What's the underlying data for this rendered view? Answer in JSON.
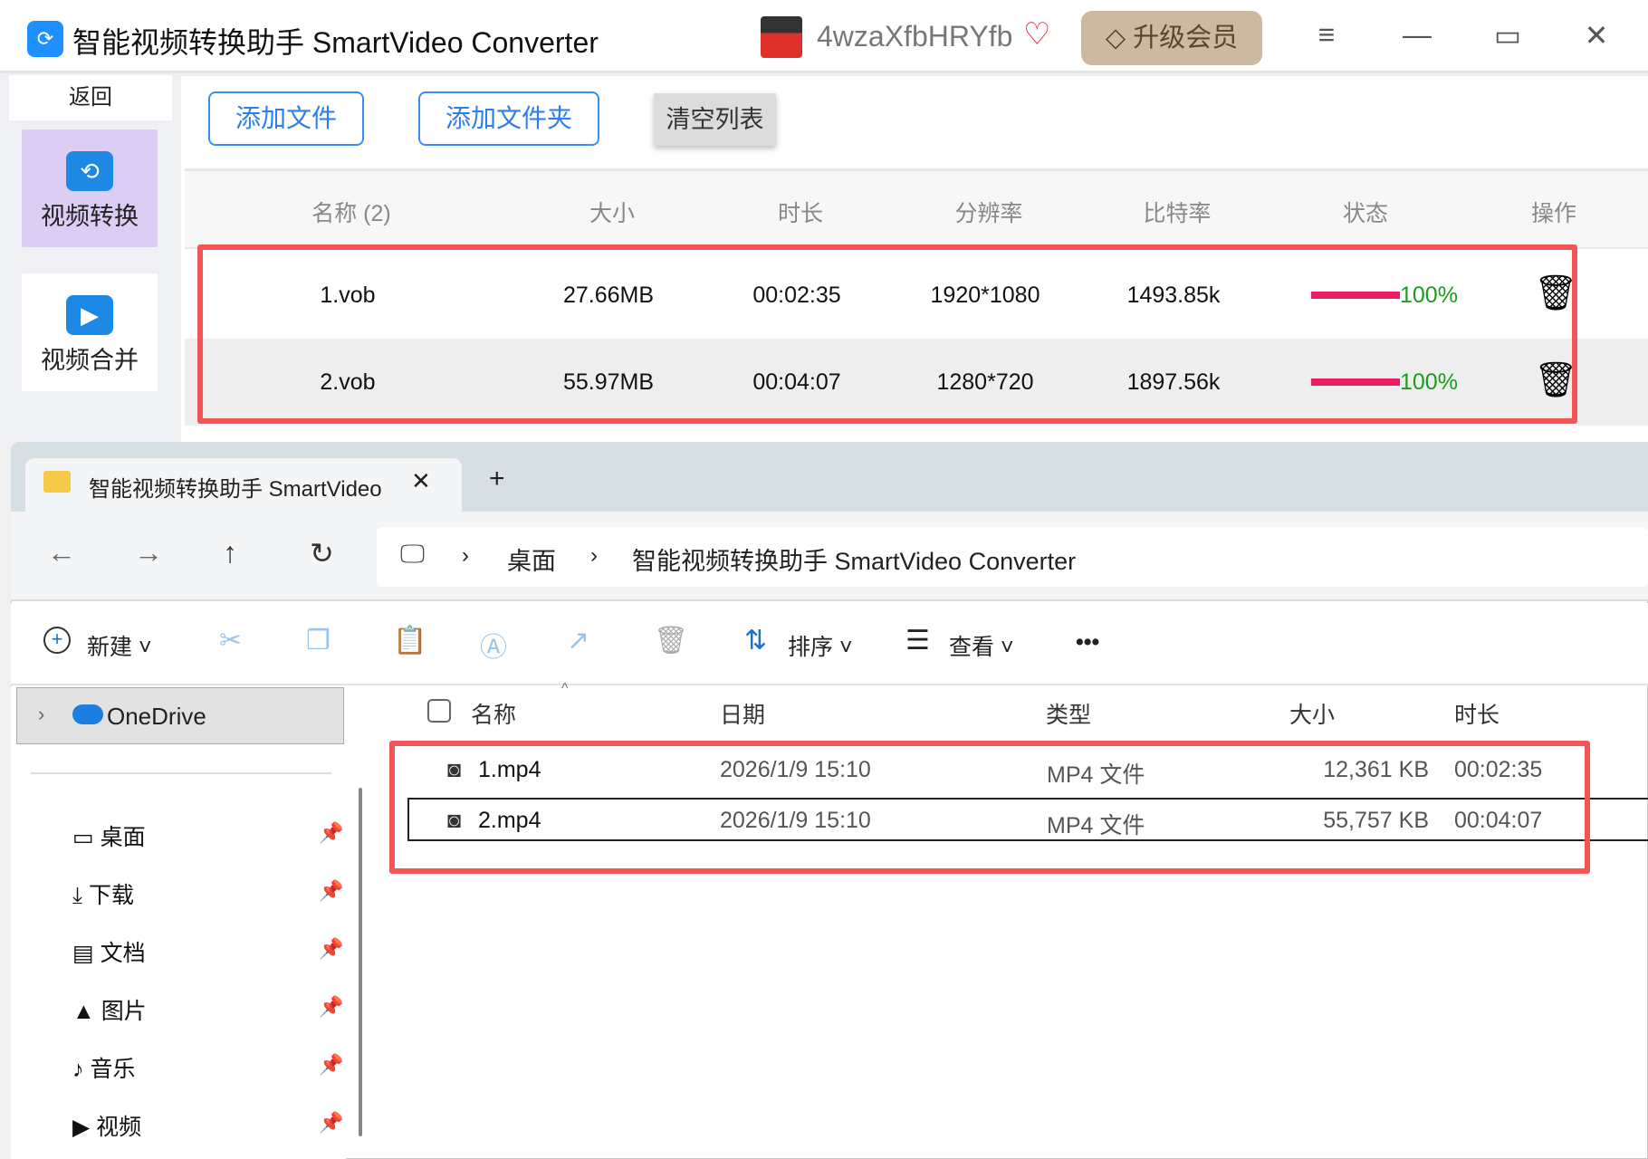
{
  "app": {
    "title": "智能视频转换助手 SmartVideo Converter",
    "username": "4wzaXfbHRYfb",
    "upgrade": "升级会员",
    "back": "返回"
  },
  "sidebar": {
    "items": [
      {
        "label": "视频转换"
      },
      {
        "label": "视频合并"
      }
    ]
  },
  "toolbar": {
    "add_file": "添加文件",
    "add_folder": "添加文件夹",
    "clear": "清空列表"
  },
  "table": {
    "headers": [
      "名称 (2)",
      "大小",
      "时长",
      "分辨率",
      "比特率",
      "状态",
      "操作"
    ],
    "rows": [
      {
        "name": "1.vob",
        "size": "27.66MB",
        "duration": "00:02:35",
        "resolution": "1920*1080",
        "bitrate": "1493.85k",
        "progress": "100%"
      },
      {
        "name": "2.vob",
        "size": "55.97MB",
        "duration": "00:04:07",
        "resolution": "1280*720",
        "bitrate": "1897.56k",
        "progress": "100%"
      }
    ]
  },
  "explorer": {
    "tab_title": "智能视频转换助手 SmartVideo",
    "breadcrumb": [
      "桌面",
      "智能视频转换助手 SmartVideo Converter"
    ],
    "commands": {
      "new": "新建",
      "sort": "排序",
      "view": "查看",
      "more": "•••"
    },
    "nav": {
      "onedrive": "OneDrive",
      "items": [
        "桌面",
        "下载",
        "文档",
        "图片",
        "音乐",
        "视频"
      ]
    },
    "columns": [
      "名称",
      "日期",
      "类型",
      "大小",
      "时长"
    ],
    "files": [
      {
        "name": "1.mp4",
        "date": "2026/1/9 15:10",
        "type": "MP4 文件",
        "size": "12,361 KB",
        "duration": "00:02:35"
      },
      {
        "name": "2.mp4",
        "date": "2026/1/9 15:10",
        "type": "MP4 文件",
        "size": "55,757 KB",
        "duration": "00:04:07"
      }
    ]
  },
  "colors": {
    "accent": "#3a8cf7",
    "progress": "#e91e63",
    "highlight": "#f25555"
  }
}
